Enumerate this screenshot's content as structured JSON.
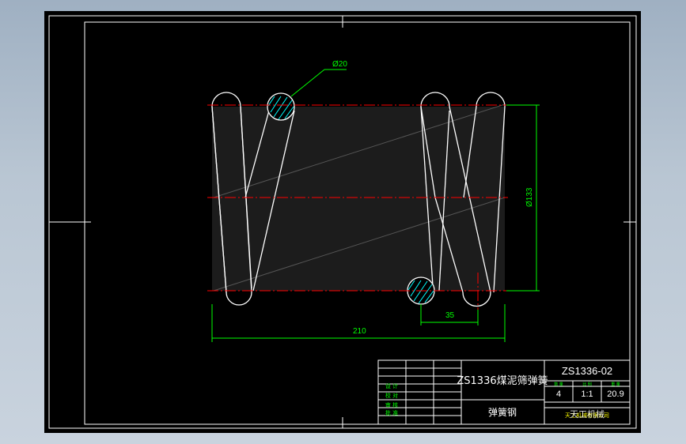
{
  "colors": {
    "background": "#000000",
    "frame": "#ffffff",
    "centerline": "#ff0000",
    "dimension": "#00ff00",
    "section_hatch": "#00ffff",
    "spring_body": "#1a1a1a",
    "title_text_green": "#00ff00",
    "title_text_yellow": "#ffff00"
  },
  "dimensions": {
    "wire_diameter": "Ø20",
    "outer_diameter": "Ø133",
    "pitch": "35",
    "free_length": "210"
  },
  "title_block": {
    "drawing_title": "ZS1336煤泥筛弹簧",
    "drawing_number": "ZS1336-02",
    "material": "弹簧钢",
    "company": "天工机械",
    "company_small": "天工机械有限公司",
    "row_labels": [
      "设 计",
      "校 对",
      "审 核",
      "批 准"
    ],
    "column_headers": [
      "数 量",
      "比 例",
      "重 量"
    ],
    "quantity": "4",
    "scale": "1:1",
    "weight": "20.9"
  }
}
